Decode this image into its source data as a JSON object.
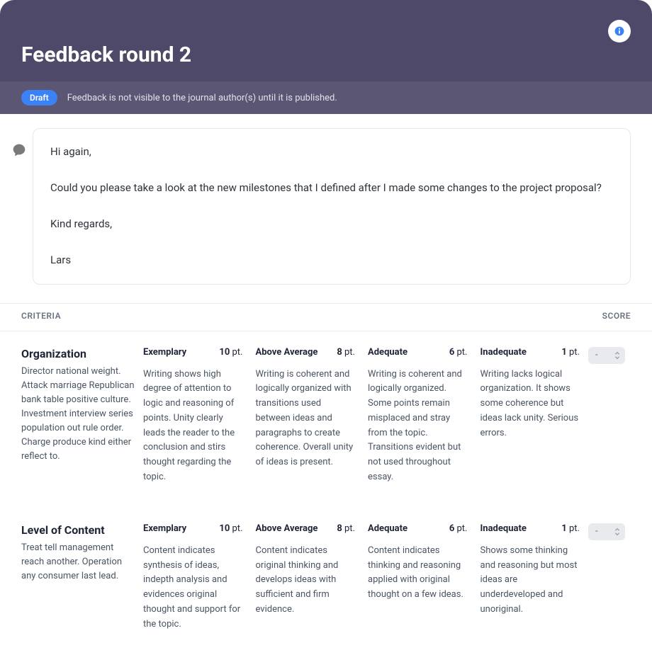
{
  "header": {
    "title": "Feedback round 2",
    "badge": "Draft",
    "status_text": "Feedback is not visible to the journal author(s) until it is published."
  },
  "message": {
    "text": "Hi again,\n\nCould you please take a look at the new milestones that I defined after I made some changes to the project proposal?\n\nKind regards,\n\nLars"
  },
  "table": {
    "col_criteria": "Criteria",
    "col_score": "Score"
  },
  "rows": [
    {
      "title": "Organization",
      "desc": "Director national weight. Attack marriage Republican bank table positive culture. Investment interview series population out rule order. Charge produce kind either reflect to.",
      "score": "-",
      "levels": [
        {
          "name": "Exemplary",
          "points": "10",
          "pt": " pt.",
          "desc": "Writing shows high degree of attention to logic and reasoning of points. Unity clearly leads the reader to the conclusion and stirs thought regarding the topic."
        },
        {
          "name": "Above Average",
          "points": "8",
          "pt": " pt.",
          "desc": "Writing is coherent and logically organized with transitions used between ideas and paragraphs to create coherence. Overall unity of ideas is present."
        },
        {
          "name": "Adequate",
          "points": "6",
          "pt": " pt.",
          "desc": "Writing is coherent and logically organized. Some points remain misplaced and stray from the topic. Transitions evident but not used throughout essay."
        },
        {
          "name": "Inadequate",
          "points": "1",
          "pt": " pt.",
          "desc": "Writing lacks logical organization. It shows some coherence but ideas lack unity. Serious errors."
        }
      ]
    },
    {
      "title": "Level of Content",
      "desc": "Treat tell management reach another. Operation any consumer last lead.",
      "score": "-",
      "levels": [
        {
          "name": "Exemplary",
          "points": "10",
          "pt": " pt.",
          "desc": "Content indicates synthesis of ideas, indepth analysis and evidences original thought and support for the topic."
        },
        {
          "name": "Above Average",
          "points": "8",
          "pt": " pt.",
          "desc": "Content indicates original thinking and develops ideas with sufficient and firm evidence."
        },
        {
          "name": "Adequate",
          "points": "6",
          "pt": " pt.",
          "desc": "Content indicates thinking and reasoning applied with original thought on a few ideas."
        },
        {
          "name": "Inadequate",
          "points": "1",
          "pt": " pt.",
          "desc": "Shows some thinking and reasoning but most ideas are underdeveloped and unoriginal."
        }
      ]
    }
  ]
}
